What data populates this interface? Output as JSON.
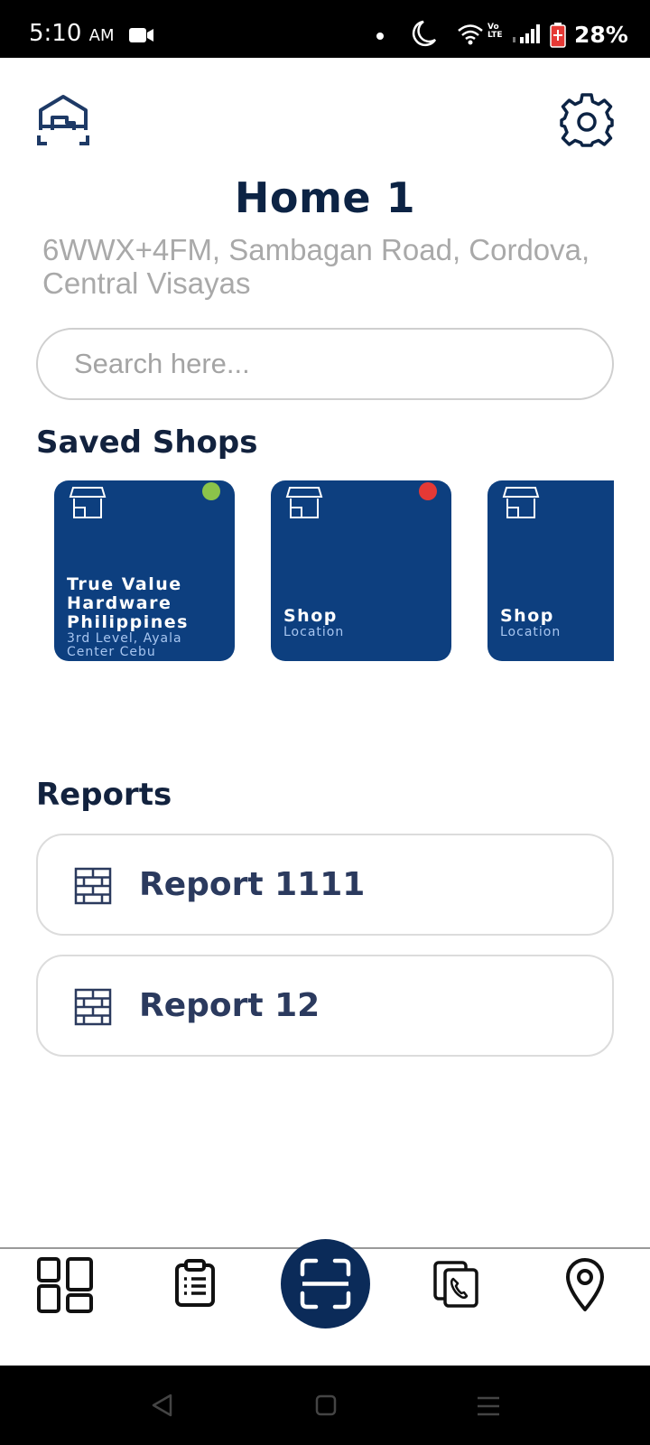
{
  "status_bar": {
    "time": "5:10",
    "ampm": "AM",
    "volte_line1": "Vo",
    "volte_line2": "LTE",
    "battery": "28%"
  },
  "header": {
    "home_icon": "home-scan-icon",
    "settings_icon": "gear-icon",
    "title": "Home 1",
    "address": "6WWX+4FM, Sambagan Road, Cordova, Central Visayas"
  },
  "search": {
    "placeholder": "Search here...",
    "value": ""
  },
  "saved_shops": {
    "heading": "Saved Shops",
    "items": [
      {
        "name": "True Value Hardware Philippines",
        "location": "3rd Level, Ayala Center Cebu",
        "status_color": "#8bc34a"
      },
      {
        "name": "Shop",
        "location": "Location",
        "status_color": "#e53935"
      },
      {
        "name": "Shop",
        "location": "Location",
        "status_color": ""
      }
    ]
  },
  "reports": {
    "heading": "Reports",
    "items": [
      {
        "label": "Report 1111",
        "icon": "brick-wall-icon"
      },
      {
        "label": "Report 12",
        "icon": "brick-wall-icon"
      }
    ]
  },
  "bottom_nav": {
    "items": [
      "dashboard-icon",
      "clipboard-icon",
      "scan-icon",
      "phone-contact-icon",
      "location-pin-icon"
    ]
  },
  "colors": {
    "brand_navy": "#0c2344",
    "card_blue": "#0d3f7f",
    "scan_button": "#0b2b59"
  }
}
